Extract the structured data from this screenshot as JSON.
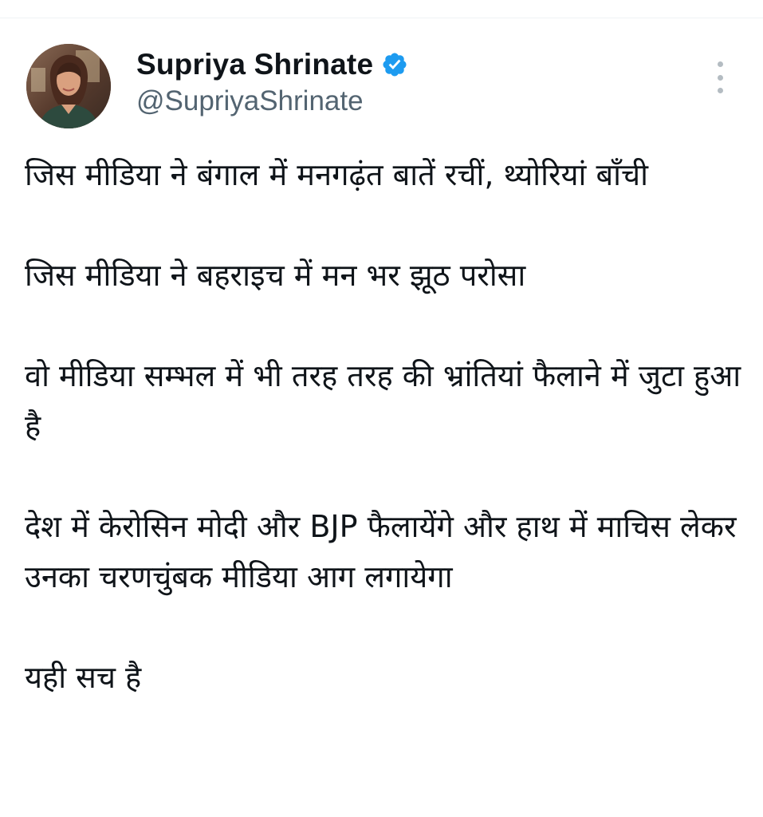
{
  "author": {
    "display_name": "Supriya Shrinate",
    "handle": "@SupriyaShrinate",
    "verified": true,
    "verified_color": "#1d9bf0",
    "avatar_icon": "profile-photo"
  },
  "menu": {
    "icon": "more-vertical-icon"
  },
  "tweet": {
    "paragraphs": [
      "जिस मीडिया ने बंगाल में मनगढ़ंत बातें रचीं, थ्योरियां बाँची",
      "जिस मीडिया ने बहराइच में मन भर झूठ परोसा",
      "वो मीडिया सम्भल में भी तरह तरह की भ्रांतियां फैलाने में जुटा हुआ है",
      "देश में केरोसिन मोदी और BJP फैलायेंगे और हाथ में माचिस लेकर उनका चरणचुंबक मीडिया आग लगायेगा",
      "यही सच है"
    ]
  },
  "colors": {
    "text": "#0f1419",
    "secondary_text": "#536471",
    "accent": "#1d9bf0",
    "divider": "#eff3f4"
  }
}
